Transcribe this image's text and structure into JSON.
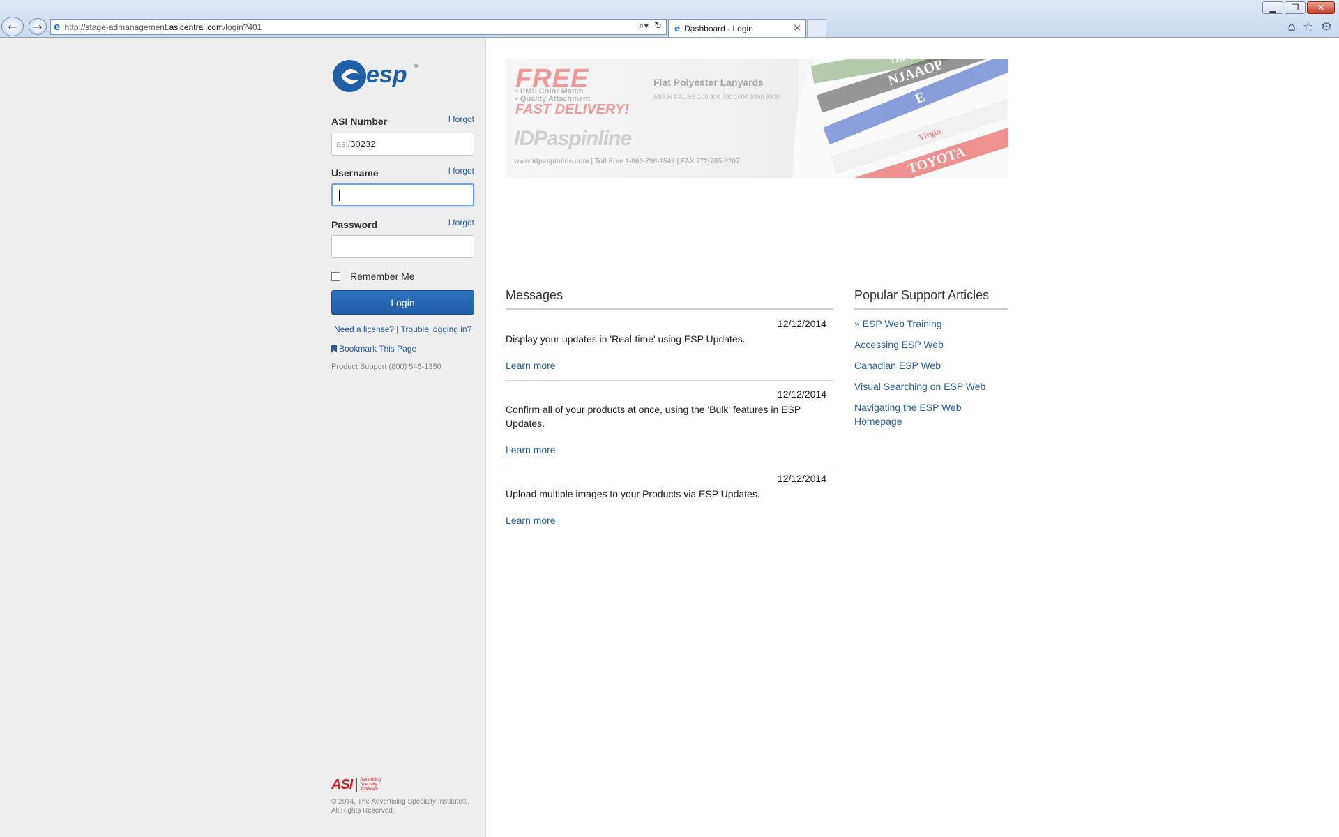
{
  "browser": {
    "url_prefix": "http://stage-admanagement.",
    "url_domain": "asicentral.com",
    "url_suffix": "/login?401",
    "tab_title": "Dashboard - Login"
  },
  "login": {
    "asi_label": "ASI Number",
    "asi_prefix": "asi/",
    "asi_value": "30232",
    "username_label": "Username",
    "username_value": "",
    "password_label": "Password",
    "forgot_label": "I forgot",
    "remember_label": "Remember Me",
    "remember_checked": false,
    "login_button": "Login",
    "need_license": "Need a license?",
    "separator": "|",
    "trouble": "Trouble logging in?",
    "bookmark": "Bookmark This Page",
    "support": "Product Support (800) 546-1350"
  },
  "footer": {
    "asi_mark": "ASI",
    "asi_sub": "Advertising Specialty Institute®",
    "copyright": "© 2014, The Advertising Specialty Institute®. All Rights Reserved."
  },
  "banner": {
    "free": "FREE",
    "bullet1": "• PMS Color Match",
    "bullet2": "• Quality Attachment",
    "fast": "FAST DELIVERY!",
    "product": "Flat Polyester Lanyards",
    "prices": "ASP/N FPL 5/8    100   300   500   1000   3000   5000",
    "brand": "IDPaspinline",
    "contact": "www.idpaspinline.com  |  Toll Free 1-866-798-1549  |  FAX 772-785-8207",
    "lanyard1": "THE WEBB",
    "lanyard2": "NJAAOP",
    "lanyard3": "E",
    "lanyard4": "Virgin",
    "lanyard5": "TOYOTA"
  },
  "messages": {
    "title": "Messages",
    "items": [
      {
        "date": "12/12/2014",
        "text": "Display your updates in 'Real-time' using ESP Updates.",
        "link": "Learn more"
      },
      {
        "date": "12/12/2014",
        "text": "Confirm all of your products at once, using the 'Bulk' features in ESP Updates.",
        "link": "Learn more"
      },
      {
        "date": "12/12/2014",
        "text": "Upload multiple images to your Products via ESP Updates.",
        "link": "Learn more"
      }
    ]
  },
  "articles": {
    "title": "Popular Support Articles",
    "items": [
      "» ESP Web Training",
      "Accessing ESP Web",
      "Canadian ESP Web",
      "Visual Searching on ESP Web",
      "Navigating the ESP Web Homepage"
    ]
  },
  "icons": {
    "back": "back-arrow-icon",
    "forward": "forward-arrow-icon",
    "search": "search-icon",
    "refresh": "refresh-icon",
    "home": "home-icon",
    "favorites": "star-icon",
    "settings": "gear-icon"
  },
  "colors": {
    "accent": "#2a5d9b",
    "button": "#2368b3",
    "brand_red": "#d0202a"
  }
}
